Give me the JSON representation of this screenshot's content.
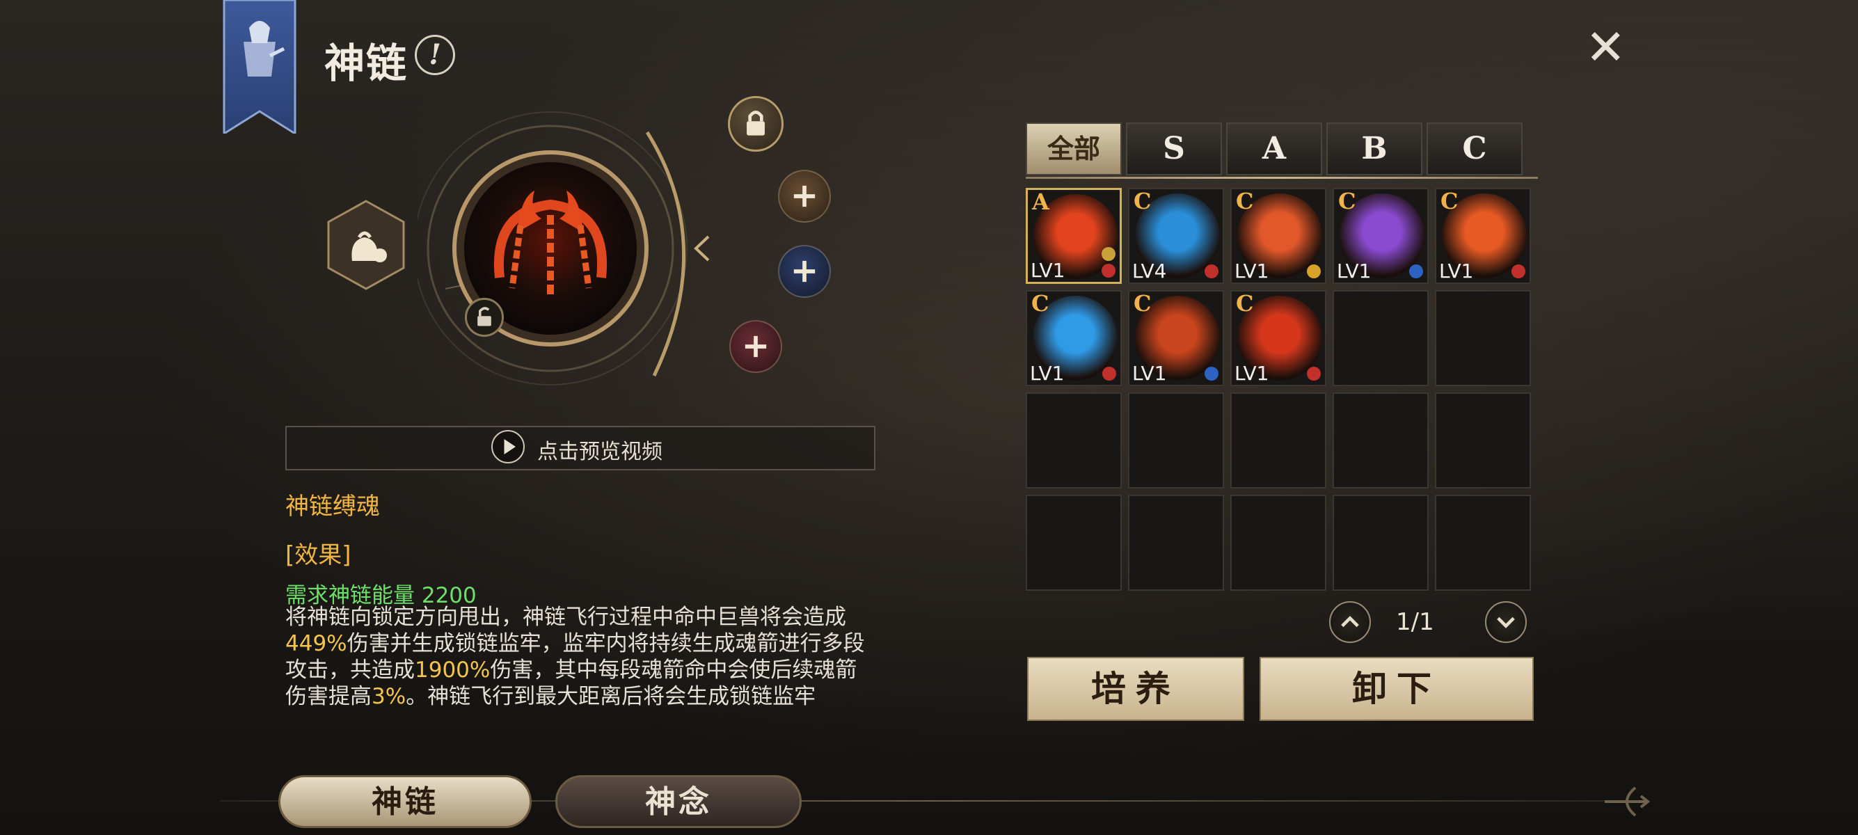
{
  "header": {
    "title": "神链",
    "info_icon": "info-icon",
    "close_icon": "close-icon"
  },
  "equip": {
    "main_icon": "chain-skill-icon",
    "locks": [
      "lock-icon",
      "unlock-icon"
    ],
    "sockets": [
      "plus-icon",
      "plus-icon",
      "plus-icon"
    ]
  },
  "preview": {
    "label": "点击预览视频"
  },
  "skill": {
    "name": "神链缚魂",
    "effect_heading": "[效果]",
    "requirement": "需求神链能量 2200",
    "desc": {
      "p1": "将神链向锁定方向甩出，神链飞行过程中命中巨兽将会造成",
      "v1": "449%",
      "p2": "伤害并生成锁链监牢，监牢内将持续生成魂箭进行多段攻击，共造成",
      "v2": "1900%",
      "p3": "伤害，其中每段魂箭命中会使后续魂箭伤害提高",
      "v3": "3%",
      "p4": "。神链飞行到最大距离后将会生成锁链监牢"
    }
  },
  "tabs": [
    "全部",
    "S",
    "A",
    "B",
    "C"
  ],
  "items": [
    {
      "grade": "A",
      "lv": "LV1",
      "color": "#e0431d",
      "gem": "#c9a33a",
      "gem2": "#c2302c",
      "selected": true
    },
    {
      "grade": "C",
      "lv": "LV4",
      "color": "#2a8fd8",
      "gem": "#c2302c"
    },
    {
      "grade": "C",
      "lv": "LV1",
      "color": "#e2582a",
      "gem": "#d6a229"
    },
    {
      "grade": "C",
      "lv": "LV1",
      "color": "#8a4bd0",
      "gem": "#2e62c2"
    },
    {
      "grade": "C",
      "lv": "LV1",
      "color": "#e85a24",
      "gem": "#c2302c"
    },
    {
      "grade": "C",
      "lv": "LV1",
      "color": "#2f9ae6",
      "gem": "#c2302c"
    },
    {
      "grade": "C",
      "lv": "LV1",
      "color": "#c9451d",
      "gem": "#2e62c2"
    },
    {
      "grade": "C",
      "lv": "LV1",
      "color": "#d6371b",
      "gem": "#c2302c"
    }
  ],
  "pager": {
    "text": "1/1"
  },
  "actions": {
    "cultivate": "培养",
    "unequip": "卸下"
  },
  "bottom_nav": {
    "chain": "神链",
    "mind": "神念"
  }
}
